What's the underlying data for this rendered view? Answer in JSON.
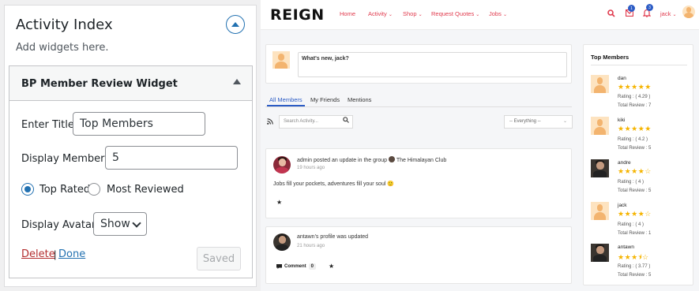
{
  "widget_area": {
    "title": "Activity Index",
    "description": "Add widgets here."
  },
  "widget": {
    "title": "BP Member Review Widget",
    "enter_title_label": "Enter Title:",
    "enter_title_value": "Top Members",
    "display_members_label": "Display Members:",
    "display_members_value": "5",
    "radio_top_rated": "Top Rated",
    "radio_most_reviewed": "Most Reviewed",
    "display_avatar_label": "Display Avatar",
    "display_avatar_value": "Show",
    "delete_label": "Delete",
    "separator": "|",
    "done_label": "Done",
    "saved_label": "Saved"
  },
  "site": {
    "logo": "REIGN",
    "nav": [
      {
        "label": "Home",
        "dropdown": false
      },
      {
        "label": "Activity",
        "dropdown": true
      },
      {
        "label": "Shop",
        "dropdown": true
      },
      {
        "label": "Request Quotes",
        "dropdown": true
      },
      {
        "label": "Jobs",
        "dropdown": true
      }
    ],
    "messages_badge": "1",
    "notifications_badge": "3",
    "user_name": "jack",
    "post_placeholder": "What's new, jack?",
    "tabs": [
      "All Members",
      "My Friends",
      "Mentions"
    ],
    "search_placeholder": "Search Activity...",
    "filter_value": "-- Everything --",
    "activities": [
      {
        "meta": "admin posted an update in the group",
        "group": "The Himalayan Club",
        "time": "19 hours ago",
        "body": "Jobs fill your pockets, adventures fill your soul 🙂"
      },
      {
        "meta": "antawn's profile was updated",
        "time": "21 hours ago",
        "comment_label": "Comment",
        "comment_count": "0"
      }
    ],
    "members_title": "Top Members",
    "members": [
      {
        "name": "dan",
        "stars": "★★★★★",
        "rating": "Rating : ( 4.29 )",
        "total": "Total Review : 7",
        "avatar": "placeholder"
      },
      {
        "name": "kiki",
        "stars": "★★★★★",
        "rating": "Rating : ( 4.2 )",
        "total": "Total Review : 5",
        "avatar": "placeholder"
      },
      {
        "name": "andre",
        "stars": "★★★★☆",
        "rating": "Rating : ( 4 )",
        "total": "Total Review : 5",
        "avatar": "photo"
      },
      {
        "name": "jack",
        "stars": "★★★★☆",
        "rating": "Rating : ( 4 )",
        "total": "Total Review : 1",
        "avatar": "placeholder"
      },
      {
        "name": "antawn",
        "stars": "★★★⯨☆",
        "rating": "Rating : ( 3.77 )",
        "total": "Total Review : 5",
        "avatar": "photo"
      }
    ]
  },
  "colors": {
    "wp_blue": "#2271b1",
    "delete_red": "#b32d2e",
    "reign_red": "#e0394c",
    "star_gold": "#f5b400",
    "tab_blue": "#2c5cc5"
  }
}
